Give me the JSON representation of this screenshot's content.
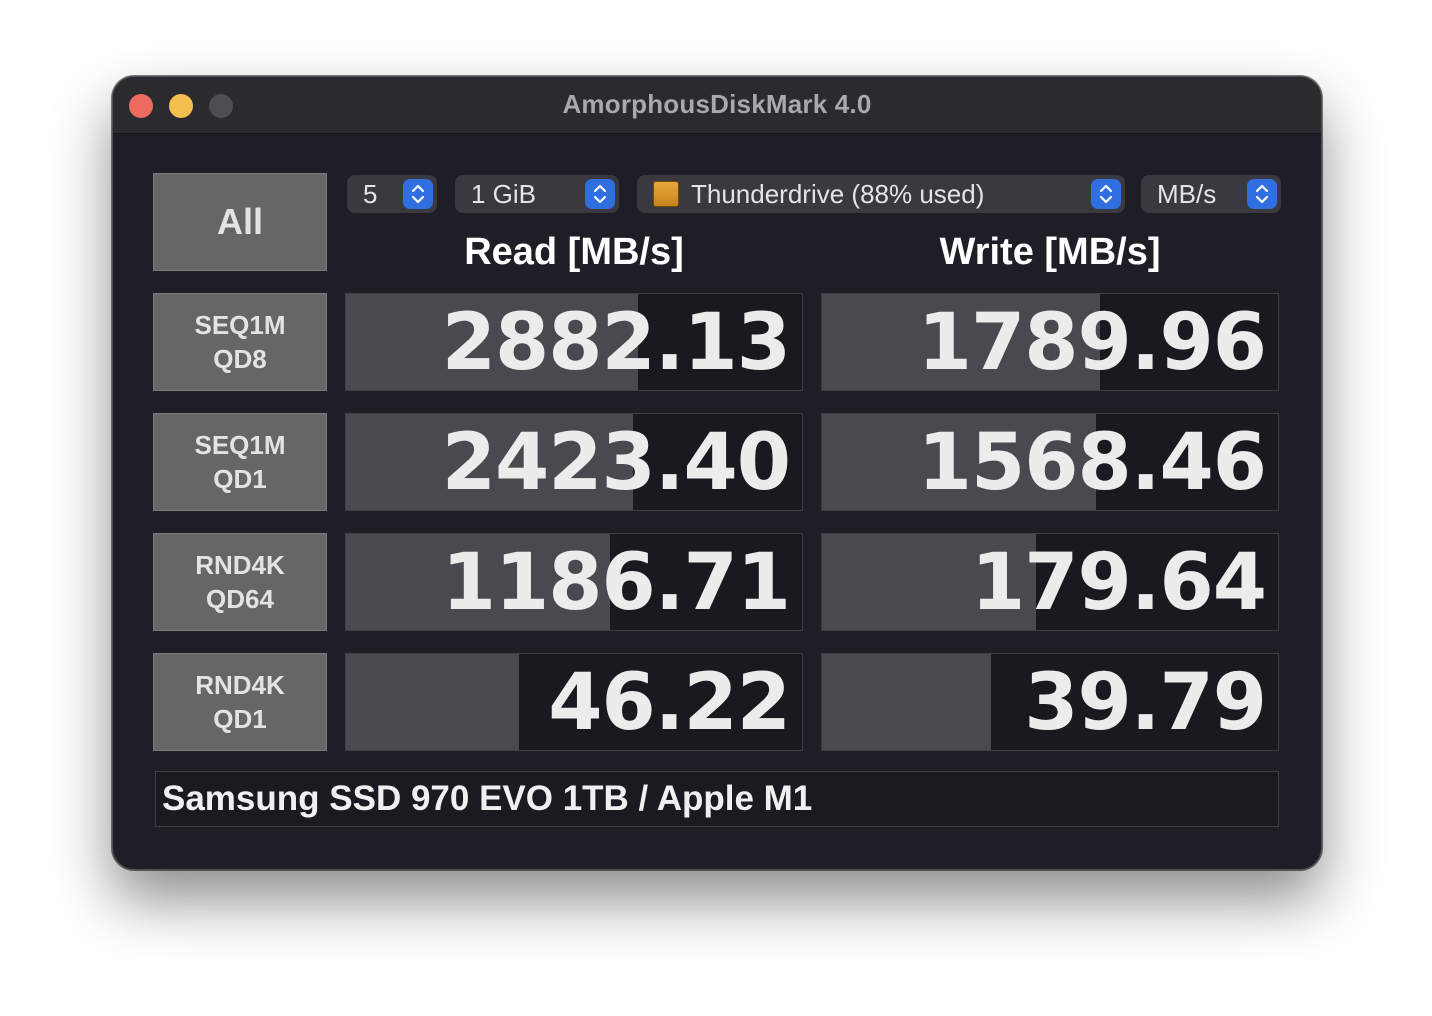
{
  "window": {
    "title": "AmorphousDiskMark 4.0"
  },
  "controls": {
    "all_label": "All",
    "count_value": "5",
    "size_value": "1 GiB",
    "drive_value": "Thunderdrive (88% used)",
    "unit_value": "MB/s"
  },
  "columns": {
    "read_header": "Read [MB/s]",
    "write_header": "Write [MB/s]"
  },
  "rows": [
    {
      "label_line1": "SEQ1M",
      "label_line2": "QD8",
      "read": "2882.13",
      "write": "1789.96",
      "read_bar_pct": 64,
      "write_bar_pct": 61
    },
    {
      "label_line1": "SEQ1M",
      "label_line2": "QD1",
      "read": "2423.40",
      "write": "1568.46",
      "read_bar_pct": 63,
      "write_bar_pct": 60
    },
    {
      "label_line1": "RND4K",
      "label_line2": "QD64",
      "read": "1186.71",
      "write": "179.64",
      "read_bar_pct": 58,
      "write_bar_pct": 47
    },
    {
      "label_line1": "RND4K",
      "label_line2": "QD1",
      "read": "46.22",
      "write": "39.79",
      "read_bar_pct": 38,
      "write_bar_pct": 37
    }
  ],
  "footer": {
    "device_info": "Samsung SSD 970 EVO 1TB / Apple M1"
  },
  "colors": {
    "background": "#1f1e26",
    "bar": "#4a494f",
    "label_box": "#666666",
    "stepper": "#2f6fe0"
  }
}
